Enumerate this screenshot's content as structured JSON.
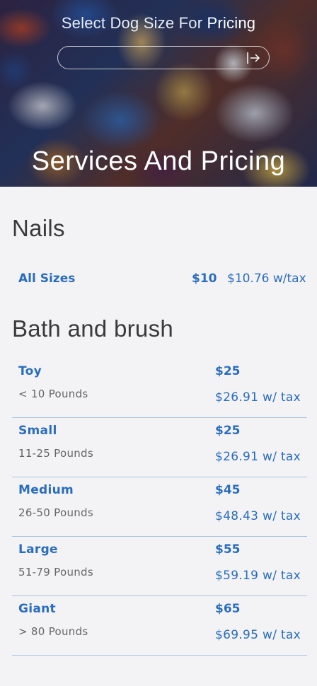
{
  "hero": {
    "prompt_prefix": "Select Dog Size For ",
    "prompt_emphasis": "Pricing",
    "title": "Services And Pricing"
  },
  "nails": {
    "title": "Nails",
    "label": "All Sizes",
    "price": "$10",
    "price_with_tax": "$10.76 w/tax"
  },
  "bath": {
    "title": "Bath and brush",
    "rows": [
      {
        "name": "Toy",
        "weight": "< 10 Pounds",
        "price": "$25",
        "price_with_tax": "$26.91 w/ tax"
      },
      {
        "name": "Small",
        "weight": "11-25 Pounds",
        "price": "$25",
        "price_with_tax": "$26.91 w/ tax"
      },
      {
        "name": "Medium",
        "weight": "26-50 Pounds",
        "price": "$45",
        "price_with_tax": "$48.43 w/ tax"
      },
      {
        "name": "Large",
        "weight": "51-79 Pounds",
        "price": "$55",
        "price_with_tax": "$59.19 w/ tax"
      },
      {
        "name": "Giant",
        "weight": "> 80 Pounds",
        "price": "$65",
        "price_with_tax": "$69.95 w/ tax"
      }
    ]
  },
  "icons": {
    "go": "arrow-right-to-bar-icon"
  },
  "colors": {
    "accent": "#2a6cbd",
    "divider": "#a9c3e3",
    "background": "#f3f3f5"
  }
}
